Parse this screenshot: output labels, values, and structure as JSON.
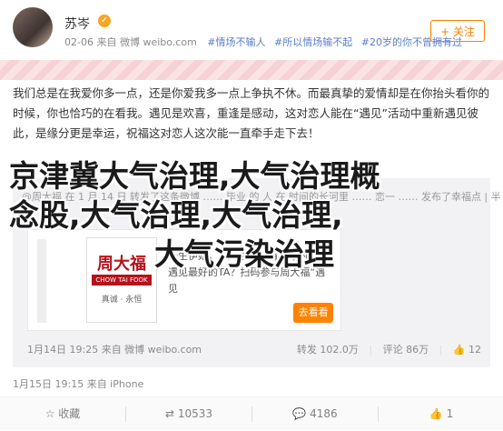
{
  "header": {
    "username": "苏岑",
    "verified_badge": "✓",
    "meta_text": "02-06 来自 微博 weibo.com",
    "time": "02-06",
    "source": "来自 微博 weibo.com",
    "tags": [
      "#情场不输人",
      "#所以情场输不起",
      "#20岁的你不曾拥有过"
    ],
    "follow_label": "+ 关注"
  },
  "post": {
    "text": "我们总是在我爱你多一点，还是你爱我多一点上争执不休。而最真挚的爱情却是在你抬头看你的时候，你也恰巧的在看我。遇见是欢喜，重逢是感动，这对恋人能在“遇见”活动中重新遇见彼此，是缘分更是幸运，祝福这对恋人这次能一直牵手走下去！"
  },
  "overlay": {
    "line1": "京津冀大气治理,大气治理概",
    "line2": "念股,大气治理,大气治理,",
    "line3": "大气污染治理"
  },
  "repost": {
    "hidden_text": "@周大福 在 1 月 14 日 转发了这条微博 ……  毕业 的 人 在 时间的长河里 …… 恋一 …… 发布了幸福点 | 半",
    "article": {
      "logo_cn": "周大福",
      "logo_en": "CHOW TAI FOOK",
      "logo_tag": "真诚 · 永恒",
      "text": "一生伊始，恋人之间，遇见你的TA，遇见最好的TA？扫码参与周大福“遇见",
      "buy_label": "去看看"
    },
    "time": "1月14日 19:25 来自 微博 weibo.com",
    "reposts": "转发 102.0万",
    "comments": "评论 86万",
    "likes": "12"
  },
  "post_footer": "1月15日 19:15 来自 iPhone",
  "actions": {
    "favorite": "收藏",
    "repost": "10533",
    "comment": "4186",
    "like": "1"
  }
}
